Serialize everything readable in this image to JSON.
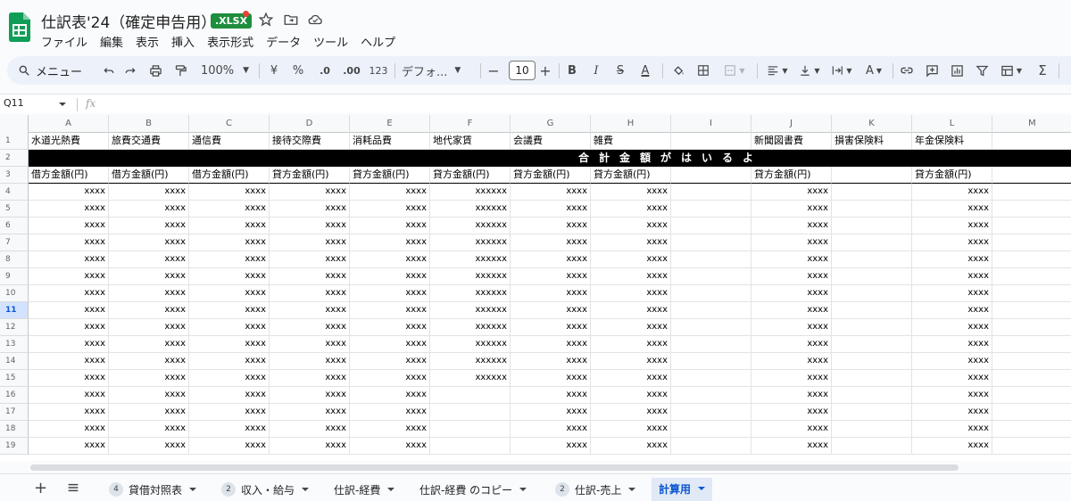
{
  "title": {
    "doc_name": "仕訳表'24（確定申告用）",
    "badge": ".XLSX"
  },
  "menu": [
    "ファイル",
    "編集",
    "表示",
    "挿入",
    "表示形式",
    "データ",
    "ツール",
    "ヘルプ"
  ],
  "toolbar": {
    "search_label": "メニュー",
    "zoom": "100%",
    "currency": "¥",
    "percent": "%",
    "dec_decrease": ".0",
    "dec_increase": ".00",
    "number_format": "123",
    "font": "デフォ...",
    "font_size": "10"
  },
  "formula_bar": {
    "cell_ref": "Q11",
    "fx": "fx"
  },
  "columns": [
    "A",
    "B",
    "C",
    "D",
    "E",
    "F",
    "G",
    "H",
    "I",
    "J",
    "K",
    "L",
    "M"
  ],
  "row1": [
    "水道光熱費",
    "旅費交通費",
    "通信費",
    "接待交際費",
    "消耗品費",
    "地代家賃",
    "会議費",
    "雑費",
    "",
    "新聞図書費",
    "損害保険料",
    "年金保険料",
    ""
  ],
  "banner": "合計金額がはいるよ",
  "row3": [
    "借方金額(円)",
    "借方金額(円)",
    "借方金額(円)",
    "貸方金額(円)",
    "貸方金額(円)",
    "貸方金額(円)",
    "貸方金額(円)",
    "貸方金額(円)",
    "",
    "貸方金額(円)",
    "",
    "貸方金額(円)",
    ""
  ],
  "data_rows": [
    {
      "n": "4",
      "cells": [
        "xxxx",
        "xxxx",
        "xxxx",
        "xxxx",
        "xxxx",
        "xxxxxx",
        "xxxx",
        "xxxx",
        "",
        "xxxx",
        "",
        "xxxx",
        ""
      ]
    },
    {
      "n": "5",
      "cells": [
        "xxxx",
        "xxxx",
        "xxxx",
        "xxxx",
        "xxxx",
        "xxxxxx",
        "xxxx",
        "xxxx",
        "",
        "xxxx",
        "",
        "xxxx",
        ""
      ]
    },
    {
      "n": "6",
      "cells": [
        "xxxx",
        "xxxx",
        "xxxx",
        "xxxx",
        "xxxx",
        "xxxxxx",
        "xxxx",
        "xxxx",
        "",
        "xxxx",
        "",
        "xxxx",
        ""
      ]
    },
    {
      "n": "7",
      "cells": [
        "xxxx",
        "xxxx",
        "xxxx",
        "xxxx",
        "xxxx",
        "xxxxxx",
        "xxxx",
        "xxxx",
        "",
        "xxxx",
        "",
        "xxxx",
        ""
      ]
    },
    {
      "n": "8",
      "cells": [
        "xxxx",
        "xxxx",
        "xxxx",
        "xxxx",
        "xxxx",
        "xxxxxx",
        "xxxx",
        "xxxx",
        "",
        "xxxx",
        "",
        "xxxx",
        ""
      ]
    },
    {
      "n": "9",
      "cells": [
        "xxxx",
        "xxxx",
        "xxxx",
        "xxxx",
        "xxxx",
        "xxxxxx",
        "xxxx",
        "xxxx",
        "",
        "xxxx",
        "",
        "xxxx",
        ""
      ]
    },
    {
      "n": "10",
      "cells": [
        "xxxx",
        "xxxx",
        "xxxx",
        "xxxx",
        "xxxx",
        "xxxxxx",
        "xxxx",
        "xxxx",
        "",
        "xxxx",
        "",
        "xxxx",
        ""
      ]
    },
    {
      "n": "11",
      "cells": [
        "xxxx",
        "xxxx",
        "xxxx",
        "xxxx",
        "xxxx",
        "xxxxxx",
        "xxxx",
        "xxxx",
        "",
        "xxxx",
        "",
        "xxxx",
        ""
      ]
    },
    {
      "n": "12",
      "cells": [
        "xxxx",
        "xxxx",
        "xxxx",
        "xxxx",
        "xxxx",
        "xxxxxx",
        "xxxx",
        "xxxx",
        "",
        "xxxx",
        "",
        "xxxx",
        ""
      ]
    },
    {
      "n": "13",
      "cells": [
        "xxxx",
        "xxxx",
        "xxxx",
        "xxxx",
        "xxxx",
        "xxxxxx",
        "xxxx",
        "xxxx",
        "",
        "xxxx",
        "",
        "xxxx",
        ""
      ]
    },
    {
      "n": "14",
      "cells": [
        "xxxx",
        "xxxx",
        "xxxx",
        "xxxx",
        "xxxx",
        "xxxxxx",
        "xxxx",
        "xxxx",
        "",
        "xxxx",
        "",
        "xxxx",
        ""
      ]
    },
    {
      "n": "15",
      "cells": [
        "xxxx",
        "xxxx",
        "xxxx",
        "xxxx",
        "xxxx",
        "xxxxxx",
        "xxxx",
        "xxxx",
        "",
        "xxxx",
        "",
        "xxxx",
        ""
      ]
    },
    {
      "n": "16",
      "cells": [
        "xxxx",
        "xxxx",
        "xxxx",
        "xxxx",
        "xxxx",
        "",
        "xxxx",
        "xxxx",
        "",
        "xxxx",
        "",
        "xxxx",
        ""
      ]
    },
    {
      "n": "17",
      "cells": [
        "xxxx",
        "xxxx",
        "xxxx",
        "xxxx",
        "xxxx",
        "",
        "xxxx",
        "xxxx",
        "",
        "xxxx",
        "",
        "xxxx",
        ""
      ]
    },
    {
      "n": "18",
      "cells": [
        "xxxx",
        "xxxx",
        "xxxx",
        "xxxx",
        "xxxx",
        "",
        "xxxx",
        "xxxx",
        "",
        "xxxx",
        "",
        "xxxx",
        ""
      ]
    },
    {
      "n": "19",
      "cells": [
        "xxxx",
        "xxxx",
        "xxxx",
        "xxxx",
        "xxxx",
        "",
        "xxxx",
        "xxxx",
        "",
        "xxxx",
        "",
        "xxxx",
        ""
      ]
    }
  ],
  "active_row": "11",
  "sheet_tabs": [
    {
      "badge": "4",
      "label": "貸借対照表"
    },
    {
      "badge": "2",
      "label": "収入・給与"
    },
    {
      "badge": "",
      "label": "仕訳-経費"
    },
    {
      "badge": "",
      "label": "仕訳-経費 のコピー"
    },
    {
      "badge": "2",
      "label": "仕訳-売上"
    },
    {
      "badge": "",
      "label": "計算用"
    }
  ],
  "active_tab": "計算用",
  "colors": {
    "sheets_green": "#0f9d58",
    "active_blue": "#0b57d0",
    "banner_bg": "#000000"
  }
}
